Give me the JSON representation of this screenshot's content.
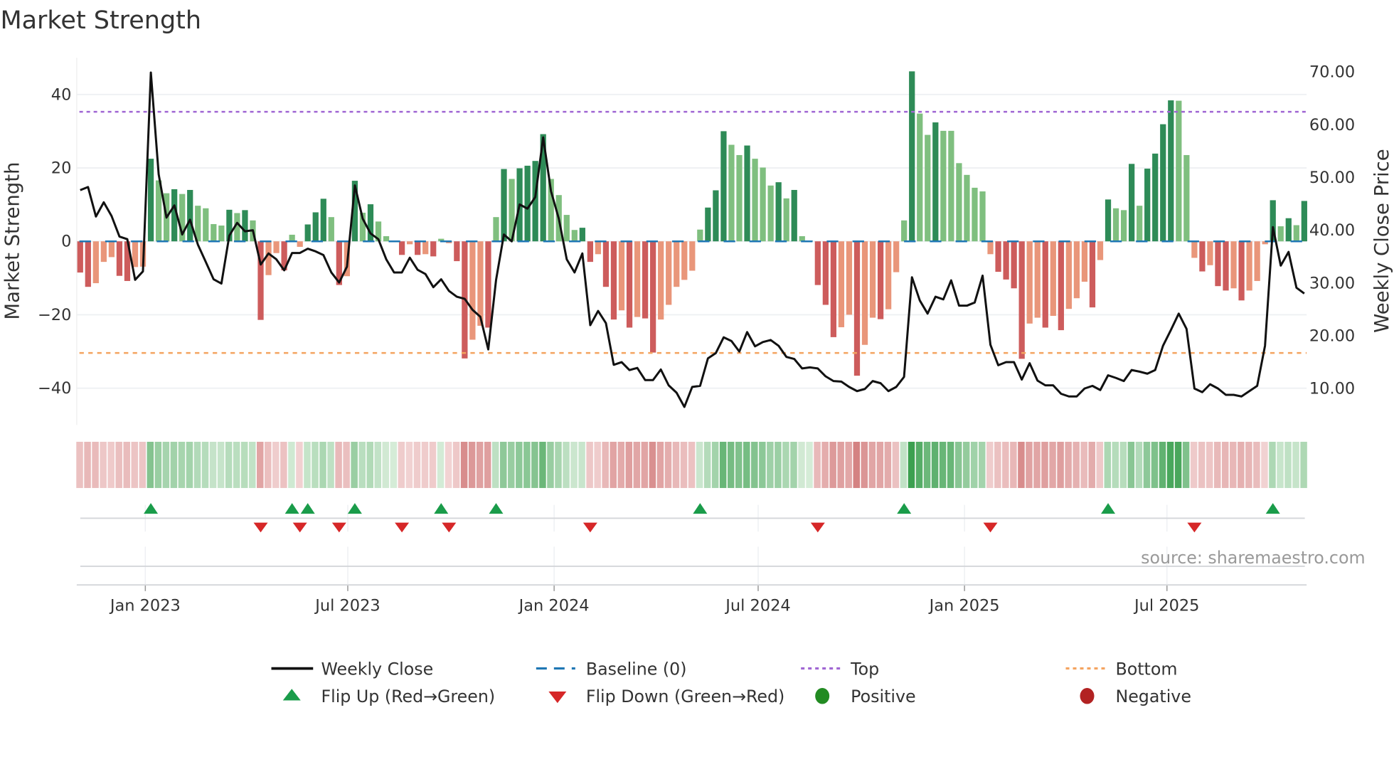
{
  "chart_data": {
    "type": "bar+line",
    "title": "Market Strength",
    "left_axis": {
      "label": "Market Strength",
      "range": [
        -50,
        50
      ],
      "ticks": [
        40,
        20,
        0,
        -20,
        -40
      ],
      "tick_labels": [
        "40",
        "20",
        "0",
        "−20",
        "−40"
      ]
    },
    "right_axis": {
      "label": "Weekly Close Price",
      "range": [
        3.1,
        72.7
      ],
      "ticks": [
        70,
        60,
        50,
        40,
        30,
        20,
        10
      ],
      "tick_labels": [
        "70.00",
        "60.00",
        "50.00",
        "40.00",
        "30.00",
        "20.00",
        "10.00"
      ]
    },
    "x_ticks": [
      {
        "label": "Jan 2023",
        "week": 8.3
      },
      {
        "label": "Jul 2023",
        "week": 34.1
      },
      {
        "label": "Jan 2024",
        "week": 60.4
      },
      {
        "label": "Jul 2024",
        "week": 86.4
      },
      {
        "label": "Jan 2025",
        "week": 112.7
      },
      {
        "label": "Jul 2025",
        "week": 138.5
      }
    ],
    "baseline": 0,
    "top_level": 35.3,
    "bottom_level": -30.4,
    "strength": [
      -8.5,
      -12.4,
      -11.4,
      -5.6,
      -4.3,
      -9.4,
      -10.8,
      -7,
      -6.9,
      22.5,
      16.6,
      13.1,
      14.2,
      12.9,
      14,
      9.7,
      9,
      4.7,
      4.3,
      8.6,
      7.7,
      8.5,
      5.7,
      -21.4,
      -9.2,
      -3.2,
      -7.9,
      1.8,
      -1.5,
      4.6,
      7.9,
      11.6,
      6.6,
      -11.9,
      -9.5,
      16.5,
      7.8,
      10.1,
      5.4,
      1.4,
      0.2,
      -3.7,
      -0.8,
      -3.7,
      -3.5,
      -4.1,
      0.7,
      -0.5,
      -5.4,
      -31.9,
      -26.8,
      -23,
      -23.5,
      6.6,
      19.7,
      17,
      19.9,
      20.6,
      21.9,
      29.2,
      17,
      12.6,
      7.2,
      3.1,
      3.7,
      -5.6,
      -3.5,
      -12.4,
      -21.3,
      -18.8,
      -23.5,
      -20.6,
      -21,
      -30.3,
      -21.3,
      -17.3,
      -12.4,
      -10.5,
      -8,
      3.2,
      9.2,
      13.9,
      30,
      26.3,
      23.5,
      26.1,
      22.5,
      20.1,
      15.2,
      16.1,
      11.7,
      14,
      1.4,
      0.2,
      -11.9,
      -17.3,
      -26.1,
      -23.4,
      -20,
      -36.6,
      -28.2,
      -20.8,
      -21.2,
      -18.5,
      -8.4,
      5.7,
      46.3,
      34.8,
      29,
      32.4,
      30.1,
      30.1,
      21.3,
      18.1,
      14.6,
      13.6,
      -3.5,
      -8.3,
      -10.4,
      -12.8,
      -32,
      -22.4,
      -20.8,
      -23.5,
      -20.3,
      -24.2,
      -18.4,
      -15.5,
      -11,
      -18,
      -5.1,
      11.4,
      9,
      8.5,
      21.1,
      9.7,
      19.8,
      23.9,
      31.9,
      38.4,
      38.3,
      23.5,
      -4.5,
      -8.2,
      -6.5,
      -12.2,
      -13.4,
      -12.8,
      -16.1,
      -13.4,
      -10.8,
      -0.8,
      11.2,
      4.1,
      6.3,
      4.4,
      11
    ],
    "weekly_close": [
      47.6,
      48.2,
      42.6,
      45.3,
      42.7,
      38.8,
      38.3,
      30.6,
      32.2,
      69.9,
      50.6,
      42.4,
      44.7,
      39.2,
      42,
      37.3,
      34,
      30.7,
      29.9,
      39,
      41.4,
      39.8,
      40,
      33.5,
      35.6,
      34.5,
      32.4,
      35.7,
      35.7,
      36.5,
      36,
      35.3,
      32,
      30.1,
      33.1,
      48.5,
      42.2,
      39.4,
      38.3,
      34.5,
      32,
      32,
      34.8,
      32.5,
      31.7,
      29.2,
      30.7,
      28.5,
      27.4,
      27,
      24.9,
      23.6,
      17.4,
      30.6,
      39.2,
      37.9,
      44.9,
      44.1,
      46.3,
      57.6,
      47.4,
      42.2,
      34.5,
      32,
      35.6,
      22,
      24.7,
      22.4,
      14.5,
      15,
      13.5,
      13.9,
      11.6,
      11.6,
      13.6,
      10.6,
      9.2,
      6.5,
      10.3,
      10.5,
      15.7,
      16.7,
      19.7,
      19,
      17,
      20.7,
      18,
      18.8,
      19.2,
      18.1,
      16,
      15.6,
      13.8,
      14,
      13.8,
      12.3,
      11.4,
      11.3,
      10.3,
      9.5,
      9.9,
      11.4,
      11,
      9.5,
      10.3,
      12.2,
      31.1,
      26.7,
      24.2,
      27.4,
      26.9,
      30.5,
      25.7,
      25.7,
      26.3,
      31.4,
      18.3,
      14.4,
      15,
      15,
      11.7,
      14.8,
      11.5,
      10.6,
      10.6,
      9,
      8.5,
      8.5,
      10,
      10.5,
      9.7,
      12.5,
      12,
      11.4,
      13.5,
      13.2,
      12.8,
      13.5,
      18.1,
      21.1,
      24.2,
      21.3,
      10,
      9.3,
      10.8,
      10,
      8.8,
      8.8,
      8.5,
      9.5,
      10.5,
      18.1,
      40.6,
      33.3,
      35.9,
      29.1,
      28
    ],
    "colors": {
      "positive_rising": "#2e8b57",
      "positive_falling": "#7fbf7f",
      "negative_rising": "#cd5c5c",
      "negative_falling": "#e9967a",
      "baseline": "#1f77b4",
      "top": "#a066d3",
      "bottom": "#f4a460",
      "line": "#111111",
      "flip_up": "#1a9c4a",
      "flip_down": "#d62728",
      "positive": "#228b22",
      "negative": "#b22222"
    },
    "legend": [
      {
        "label": "Weekly Close"
      },
      {
        "label": "Baseline (0)"
      },
      {
        "label": "Top"
      },
      {
        "label": "Bottom"
      },
      {
        "label": "Flip Up (Red→Green)"
      },
      {
        "label": "Flip Down (Green→Red)"
      },
      {
        "label": "Positive"
      },
      {
        "label": "Negative"
      }
    ],
    "legend_placement": "bottom",
    "source": "source: sharemaestro.com"
  }
}
